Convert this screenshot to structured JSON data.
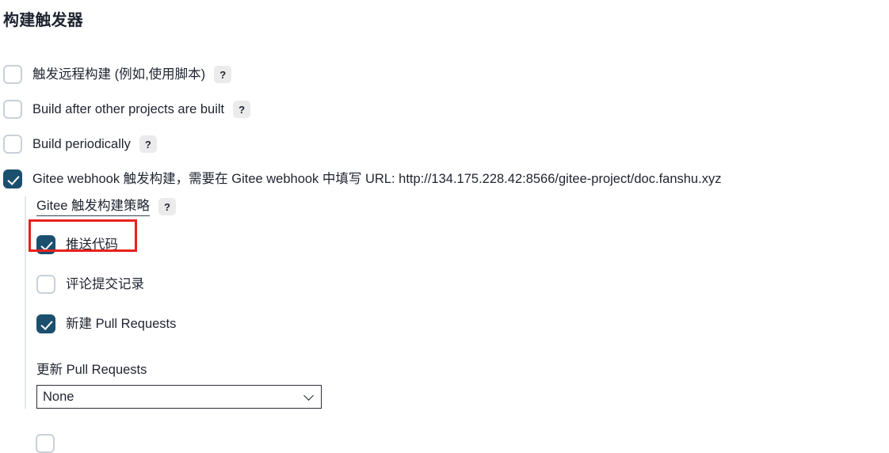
{
  "page": {
    "title": "构建触发器"
  },
  "triggers": [
    {
      "id": "trigger-remote-build",
      "label": "触发远程构建 (例如,使用脚本)",
      "checked": false,
      "help": "?"
    },
    {
      "id": "build-after-other-projects",
      "label": "Build after other projects are built",
      "checked": false,
      "help": "?"
    },
    {
      "id": "build-periodically",
      "label": "Build periodically",
      "checked": false,
      "help": "?"
    },
    {
      "id": "gitee-webhook",
      "label": "Gitee webhook 触发构建，需要在 Gitee webhook 中填写 URL: http://134.175.228.42:8566/gitee-project/doc.fanshu.xyz",
      "checked": true,
      "help": null
    }
  ],
  "gitee_webhook_url": "http://134.175.228.42:8566/gitee-project/doc.fanshu.xyz",
  "nested": {
    "heading": "Gitee 触发构建策略",
    "heading_help": "?",
    "options": [
      {
        "id": "push-code",
        "label": "推送代码",
        "checked": true
      },
      {
        "id": "comment-commit-record",
        "label": "评论提交记录",
        "checked": false
      },
      {
        "id": "new-pull-requests",
        "label": "新建 Pull Requests",
        "checked": true
      }
    ],
    "update_pr": {
      "label": "更新 Pull Requests",
      "value": "None",
      "options": [
        "None"
      ]
    }
  },
  "annotation": {
    "color": "#e8211c",
    "target": "push-code"
  },
  "colors": {
    "checked_checkbox": "#1a4f6e",
    "unchecked_border": "#c8d1d9",
    "help_badge": "#ebebeb",
    "text": "#1f2430",
    "nested_rule": "#e3e7ea"
  }
}
